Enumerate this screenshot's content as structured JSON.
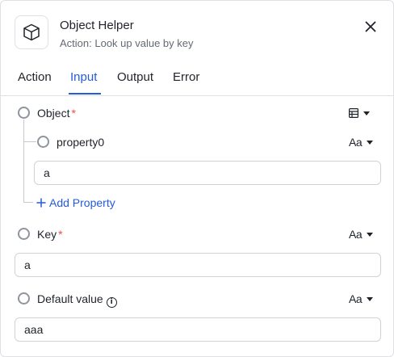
{
  "header": {
    "title": "Object Helper",
    "subtitle": "Action: Look up value by key",
    "icon": "cube-icon"
  },
  "tabs": [
    {
      "label": "Action",
      "active": false
    },
    {
      "label": "Input",
      "active": true
    },
    {
      "label": "Output",
      "active": false
    },
    {
      "label": "Error",
      "active": false
    }
  ],
  "fields": {
    "object": {
      "label": "Object",
      "required": true,
      "required_mark": "*",
      "type_icon": "table-icon"
    },
    "property0": {
      "label": "property0",
      "value": "a",
      "type_text": "Aa"
    },
    "add_property": "Add Property",
    "key": {
      "label": "Key",
      "required": true,
      "required_mark": "*",
      "value": "a",
      "type_text": "Aa"
    },
    "default_value": {
      "label": "Default value",
      "info_glyph": "i",
      "value": "aaa",
      "type_text": "Aa"
    }
  },
  "colors": {
    "accent": "#245bdb",
    "required": "#f54a45",
    "border": "#dee0e3"
  }
}
